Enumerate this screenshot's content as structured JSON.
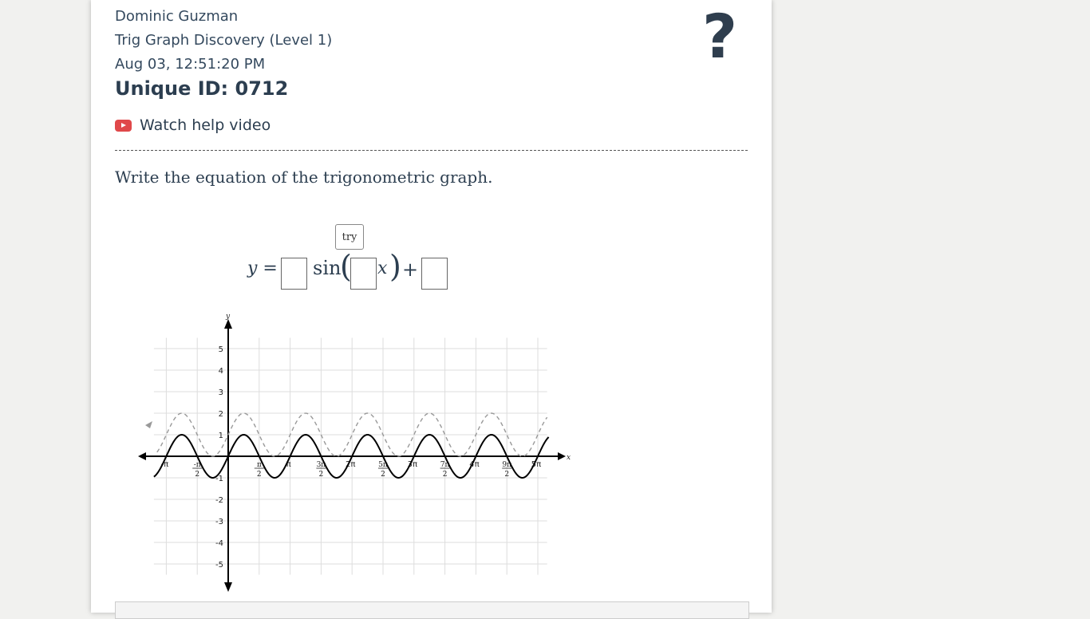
{
  "header": {
    "student_name": "Dominic Guzman",
    "assignment": "Trig Graph Discovery (Level 1)",
    "timestamp": "Aug 03, 12:51:20 PM",
    "unique_id": "Unique ID: 0712",
    "help_icon": "question-mark-icon",
    "video_link": "Watch help video"
  },
  "question": {
    "prompt": "Write the equation of the trigonometric graph.",
    "try_label": "try",
    "equation_parts": {
      "lhs": "y =",
      "func": "sin",
      "open_paren": "(",
      "var": "x",
      "close_paren": ")",
      "plus": "+"
    },
    "inputs": [
      "",
      "",
      ""
    ]
  },
  "graph": {
    "x_axis_label": "x",
    "y_axis_label": "y",
    "y_ticks": [
      5,
      4,
      3,
      2,
      1,
      -1,
      -2,
      -3,
      -4,
      -5
    ],
    "x_ticks": [
      {
        "k": -2,
        "label": "-π"
      },
      {
        "k": -1,
        "num": "-π",
        "den": "2"
      },
      {
        "k": 1,
        "num": "π",
        "den": "2"
      },
      {
        "k": 2,
        "label": "π"
      },
      {
        "k": 3,
        "num": "3π",
        "den": "2"
      },
      {
        "k": 4,
        "label": "2π"
      },
      {
        "k": 5,
        "num": "5π",
        "den": "2"
      },
      {
        "k": 6,
        "label": "3π"
      },
      {
        "k": 7,
        "num": "7π",
        "den": "2"
      },
      {
        "k": 8,
        "label": "4π"
      },
      {
        "k": 9,
        "num": "9π",
        "den": "2"
      },
      {
        "k": 10,
        "label": "5π"
      }
    ],
    "solid_curve": "sin(2x)",
    "dashed_curve": "sin(2x)+1",
    "colors": {
      "solid": "#000000",
      "dashed": "#999999",
      "grid": "#dddddd"
    }
  }
}
